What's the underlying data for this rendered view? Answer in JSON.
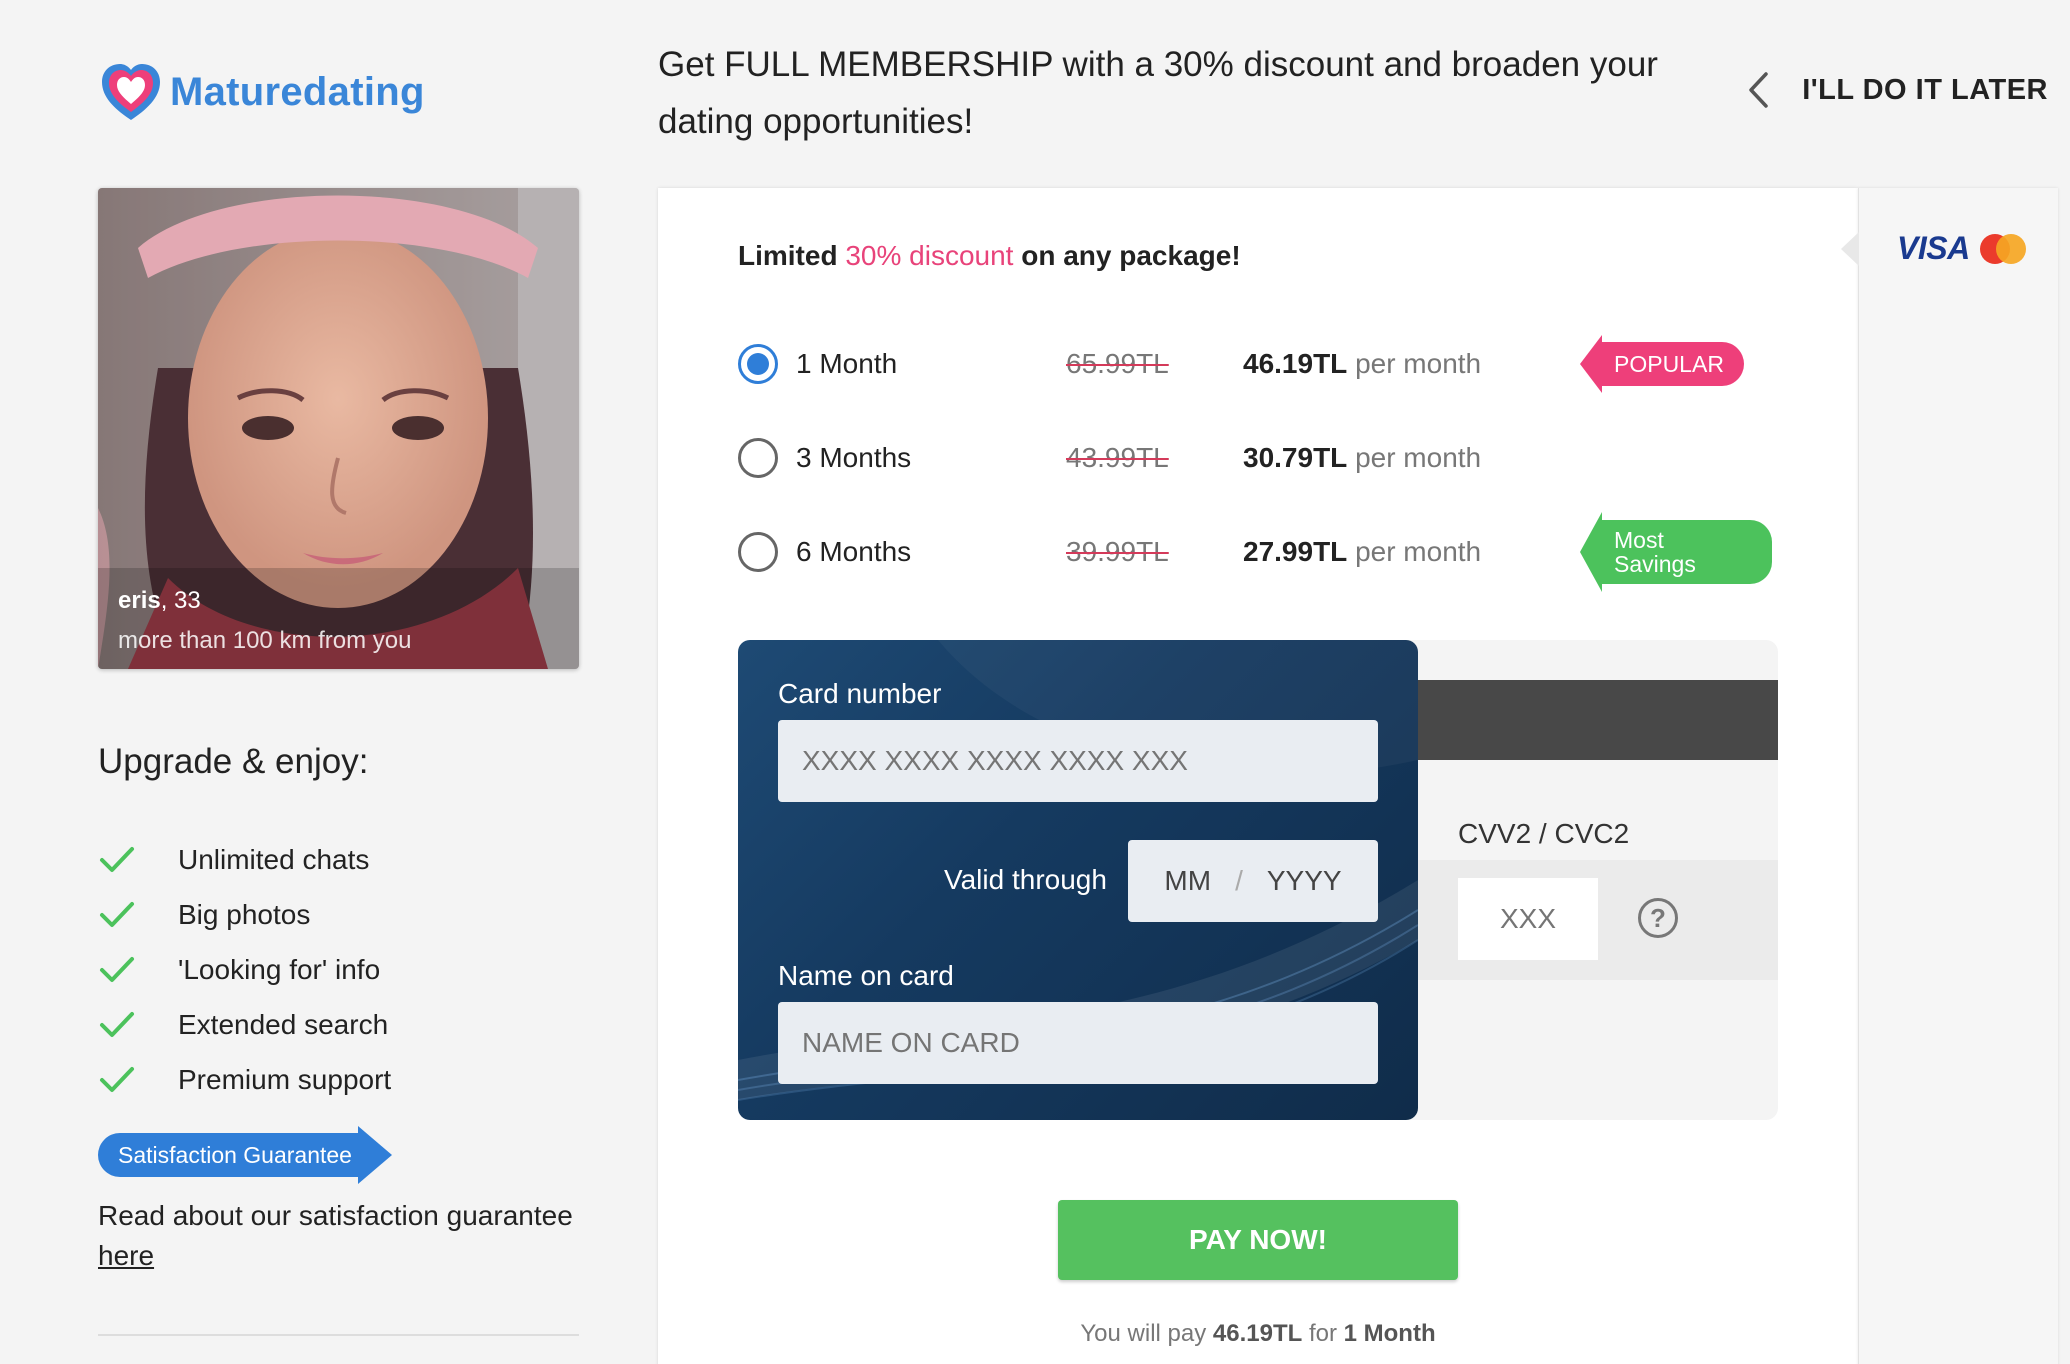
{
  "header": {
    "brand": "Maturedating",
    "headline": "Get FULL MEMBERSHIP with a 30% discount and broaden your dating opportunities!",
    "later_label": "I'LL DO IT LATER"
  },
  "profile": {
    "name": "eris",
    "age": ", 33",
    "distance": "more than 100 km from you"
  },
  "benefits": {
    "title": "Upgrade & enjoy:",
    "items": [
      "Unlimited chats",
      "Big photos",
      "'Looking for' info",
      "Extended search",
      "Premium support"
    ]
  },
  "guarantee": {
    "badge": "Satisfaction Guarantee",
    "text": "Read about our satisfaction guarantee",
    "link": "here"
  },
  "offer": {
    "prefix": "Limited ",
    "highlight": "30% discount",
    "suffix": " on any package!"
  },
  "plans": [
    {
      "name": "1 Month",
      "old_price": "65.99TL",
      "price": "46.19TL",
      "unit": "per month",
      "tag": "POPULAR",
      "selected": true
    },
    {
      "name": "3 Months",
      "old_price": "43.99TL",
      "price": "30.79TL",
      "unit": "per month",
      "tag": "",
      "selected": false
    },
    {
      "name": "6 Months",
      "old_price": "39.99TL",
      "price": "27.99TL",
      "unit": "per month",
      "tag": "Most Savings",
      "selected": false
    }
  ],
  "payment_methods": {
    "visa": "VISA",
    "mastercard": "mastercard-icon"
  },
  "card": {
    "number_label": "Card number",
    "number_placeholder": "XXXX XXXX XXXX XXXX XXX",
    "valid_label": "Valid through",
    "month_placeholder": "MM",
    "separator": "/",
    "year_placeholder": "YYYY",
    "name_label": "Name on card",
    "name_placeholder": "NAME ON CARD",
    "cvv_label": "CVV2 / CVC2",
    "cvv_placeholder": "XXX",
    "help": "?"
  },
  "pay_button": "PAY NOW!",
  "summary": {
    "prefix": "You will pay ",
    "amount": "46.19TL",
    "mid": " for ",
    "period": "1 Month"
  },
  "colors": {
    "brand": "#3a86d8",
    "pink": "#ee3f7a",
    "green": "#55c15f",
    "blue": "#2f7ed8",
    "card": "#153a60"
  }
}
